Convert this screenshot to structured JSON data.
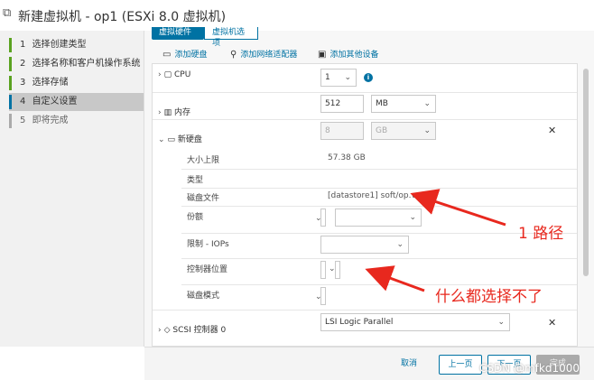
{
  "window": {
    "title": "新建虚拟机 - op1 (ESXi 8.0 虚拟机)"
  },
  "steps": [
    {
      "num": "1",
      "label": "选择创建类型"
    },
    {
      "num": "2",
      "label": "选择名称和客户机操作系统"
    },
    {
      "num": "3",
      "label": "选择存储"
    },
    {
      "num": "4",
      "label": "自定义设置"
    },
    {
      "num": "5",
      "label": "即将完成"
    }
  ],
  "tabs": {
    "active": "虚拟硬件",
    "inactive": "虚拟机选项"
  },
  "toolbar": {
    "add_disk": "添加硬盘",
    "add_nic": "添加网络适配器",
    "add_other": "添加其他设备"
  },
  "cpu": {
    "label": "CPU",
    "value": "1"
  },
  "memory": {
    "label": "内存",
    "value": "512",
    "unit": "MB"
  },
  "disk": {
    "label": "新硬盘",
    "size_value": "8",
    "size_unit": "GB",
    "max_size_label": "大小上限",
    "max_size_value": "57.38 GB",
    "type_label": "类型",
    "file_label": "磁盘文件",
    "file_value": "[datastore1] soft/op.vmdk",
    "shares_label": "份额",
    "limit_label": "限制 - IOPs",
    "controller_location_label": "控制器位置",
    "disk_mode_label": "磁盘模式"
  },
  "scsi": {
    "label": "SCSI 控制器 0",
    "value": "LSI Logic Parallel"
  },
  "footer": {
    "back": "上一页",
    "next": "下一页",
    "finish": "完成",
    "cancel": "取消"
  },
  "annotations": {
    "path_note": "1 路径",
    "cannot_select_note": "什么都选择不了"
  },
  "watermark": "CSDN @mfkd1000",
  "colors": {
    "accent": "#0072a3",
    "annotation": "#e8281e",
    "step_done": "#5aa220"
  }
}
